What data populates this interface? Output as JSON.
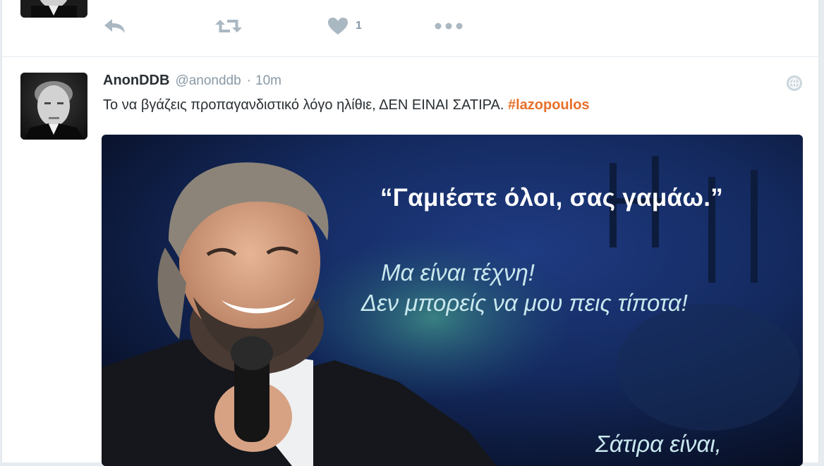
{
  "prev_tweet": {
    "like_count": "1",
    "icons": [
      "reply-icon",
      "retweet-icon",
      "heart-icon",
      "more-icon"
    ]
  },
  "tweet": {
    "author_name": "AnonDDB",
    "handle": "@anonddb",
    "separator": "·",
    "time": "10m",
    "text": "Το να βγάζεις προπαγανδιστικό λόγο ηλίθιε, ΔΕΝ ΕΙΝΑΙ ΣΑΤΙΡΑ. ",
    "hashtag": "#lazopoulos",
    "image": {
      "quote": "“Γαμιέστε όλοι, σας γαμάω.”",
      "line1": "Μα είναι τέχνη!",
      "line2": "Δεν μπορείς να μου πεις τίποτα!",
      "line3": "Σάτιρα είναι,"
    }
  },
  "colors": {
    "hashtag": "#e8702a",
    "muted": "#8899a6",
    "text": "#292f33",
    "background": "#e6ecf0"
  }
}
